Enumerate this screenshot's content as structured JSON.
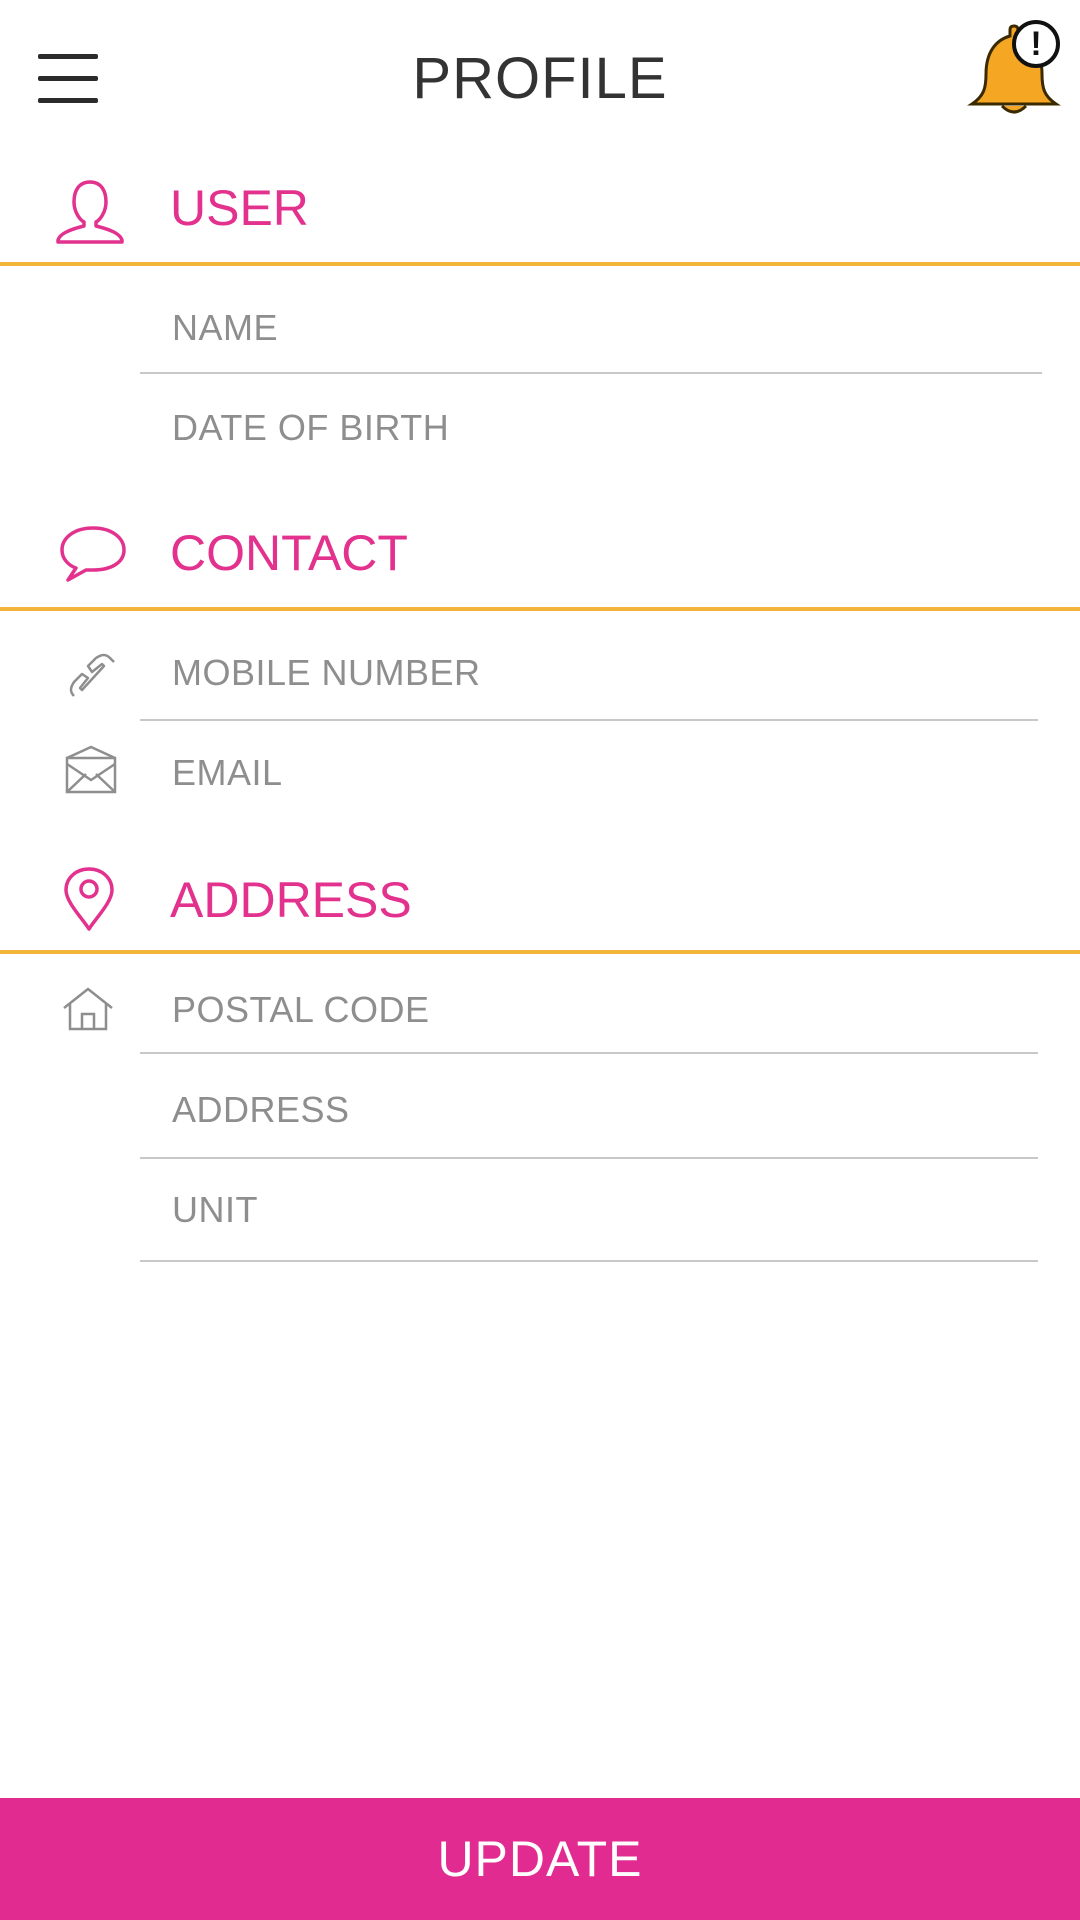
{
  "header": {
    "title": "PROFILE",
    "menu_icon": "hamburger-menu-icon",
    "notification_icon": "bell-icon",
    "notification_badge": "!"
  },
  "sections": {
    "user": {
      "title": "USER",
      "icon": "user-icon",
      "fields": {
        "name": "NAME",
        "dob": "DATE OF BIRTH"
      }
    },
    "contact": {
      "title": "CONTACT",
      "icon": "speech-bubble-icon",
      "fields": {
        "mobile": "MOBILE NUMBER",
        "email": "EMAIL"
      }
    },
    "address": {
      "title": "ADDRESS",
      "icon": "location-pin-icon",
      "fields": {
        "postal": "POSTAL CODE",
        "address": "ADDRESS",
        "unit": "UNIT"
      }
    }
  },
  "footer": {
    "update_label": "UPDATE"
  },
  "colors": {
    "accent": "#e2328e",
    "divider": "#f2b43b",
    "bell": "#f5a623",
    "button": "#e22b91"
  }
}
